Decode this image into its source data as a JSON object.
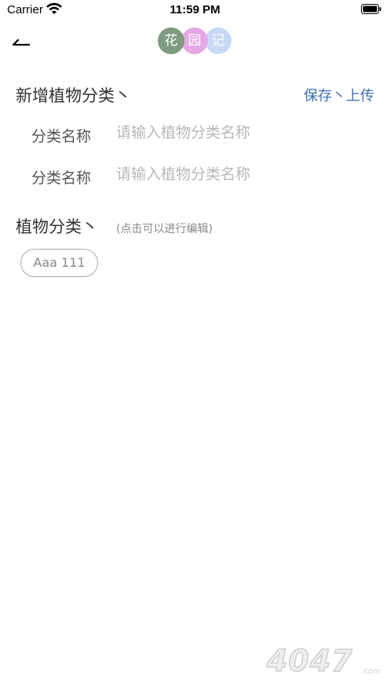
{
  "status_bar": {
    "carrier": "Carrier",
    "time": "11:59 PM"
  },
  "nav": {
    "logo_chars": [
      "花",
      "园",
      "记"
    ],
    "logo_colors": [
      "#7f9b80",
      "#e6a7e5",
      "#c7d9f5"
    ]
  },
  "new_category": {
    "title": "新增植物分类丶",
    "save_label": "保存丶上传",
    "rows": [
      {
        "label": "分类名称",
        "placeholder": "请输入植物分类名称",
        "value": ""
      },
      {
        "label": "分类名称",
        "placeholder": "请输入植物分类名称",
        "value": ""
      }
    ]
  },
  "plant_categories": {
    "title": "植物分类丶",
    "hint": "(点击可以进行编辑)",
    "items": [
      "Aaa 111"
    ]
  },
  "watermark": {
    "text": "4047",
    "suffix": ".com"
  },
  "colors": {
    "link": "#3f6fb4",
    "placeholder": "#b8b8b8"
  }
}
